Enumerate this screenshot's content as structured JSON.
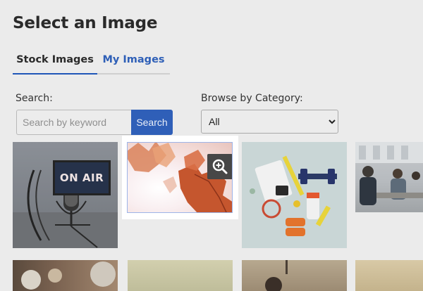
{
  "page": {
    "title": "Select an Image"
  },
  "tabs": [
    {
      "label": "Stock Images",
      "active": true
    },
    {
      "label": "My Images",
      "active": false
    }
  ],
  "search": {
    "label": "Search:",
    "placeholder": "Search by keyword",
    "value": "",
    "button_label": "Search"
  },
  "category": {
    "label": "Browse by Category:",
    "selected": "All"
  },
  "images": [
    {
      "subject": "on-air-microphone",
      "sign_text": "ON AIR"
    },
    {
      "subject": "autumn-leaves",
      "selected": true,
      "zoom_icon": "zoom-in-icon"
    },
    {
      "subject": "fitness-equipment"
    },
    {
      "subject": "office-meeting"
    },
    {
      "subject": "food-table"
    },
    {
      "subject": "seaside"
    },
    {
      "subject": "lamp-interior"
    },
    {
      "subject": "sand-beach"
    }
  ],
  "colors": {
    "accent": "#2f5fb8",
    "tab_inactive": "#2e5fb7",
    "overlay": "#ebebeb"
  }
}
